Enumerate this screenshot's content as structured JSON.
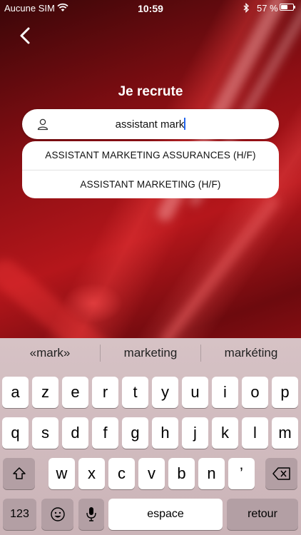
{
  "status_bar": {
    "carrier": "Aucune SIM",
    "time": "10:59",
    "battery": "57 %"
  },
  "page": {
    "title": "Je recrute"
  },
  "search": {
    "value": "assistant mark"
  },
  "suggestions": [
    "ASSISTANT MARKETING ASSURANCES (H/F)",
    "ASSISTANT MARKETING (H/F)"
  ],
  "keyboard": {
    "predictions": [
      "«mark»",
      "marketing",
      "markéting"
    ],
    "row1": [
      "a",
      "z",
      "e",
      "r",
      "t",
      "y",
      "u",
      "i",
      "o",
      "p"
    ],
    "row2": [
      "q",
      "s",
      "d",
      "f",
      "g",
      "h",
      "j",
      "k",
      "l",
      "m"
    ],
    "row3": [
      "w",
      "x",
      "c",
      "v",
      "b",
      "n",
      "’"
    ],
    "numbers_key": "123",
    "space_key": "espace",
    "return_key": "retour"
  }
}
